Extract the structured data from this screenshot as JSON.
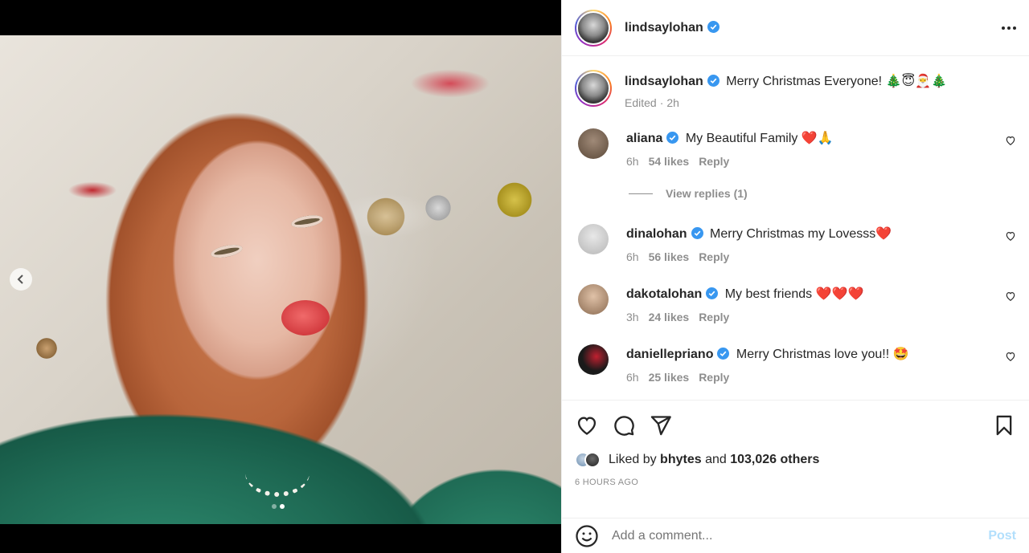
{
  "post": {
    "author": "lindsaylohan",
    "caption": "Merry Christmas Everyone!",
    "caption_emoji": "🎄😇🎅🎄",
    "edited_label": "Edited",
    "time": "2h"
  },
  "comments": [
    {
      "user": "aliana",
      "text": "My Beautiful Family",
      "emoji": "❤️🙏",
      "time": "6h",
      "likes": "54 likes",
      "reply": "Reply",
      "view_replies": "View replies (1)"
    },
    {
      "user": "dinalohan",
      "text": "Merry Christmas my Lovesss",
      "emoji": "❤️",
      "time": "6h",
      "likes": "56 likes",
      "reply": "Reply"
    },
    {
      "user": "dakotalohan",
      "text": "My best friends",
      "emoji": "❤️❤️❤️",
      "time": "3h",
      "likes": "24 likes",
      "reply": "Reply"
    },
    {
      "user": "daniellepriano",
      "text": "Merry Christmas love you!!",
      "emoji": "🤩",
      "time": "6h",
      "likes": "25 likes",
      "reply": "Reply"
    }
  ],
  "likes": {
    "liked_by": "Liked by",
    "user": "bhytes",
    "and": "and",
    "others": "103,026 others"
  },
  "timestamp": "6 HOURS AGO",
  "add_comment": {
    "placeholder": "Add a comment...",
    "post": "Post"
  },
  "colors": {
    "verified": "#3897f0",
    "post_disabled": "#b2dffc",
    "heart_red": "#ed4956"
  },
  "carousel": {
    "slides": 2,
    "active": 2
  }
}
